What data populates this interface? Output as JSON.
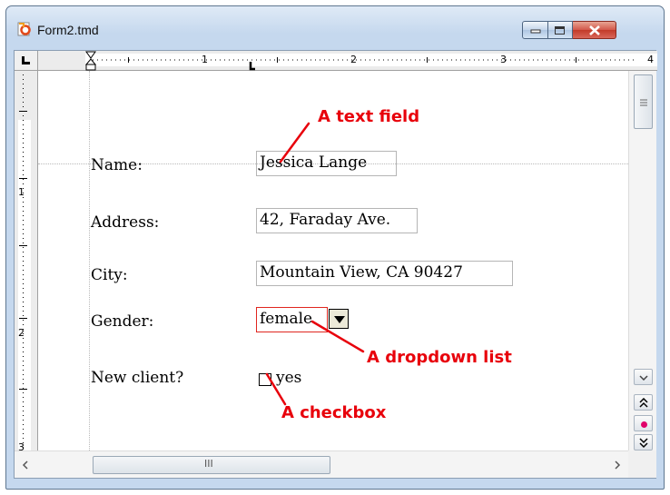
{
  "window": {
    "title": "Form2.tmd"
  },
  "ruler": {
    "h_marks": [
      "1",
      "2",
      "3",
      "4"
    ],
    "v_marks": [
      "1",
      "2",
      "3"
    ]
  },
  "form": {
    "fields": [
      {
        "label": "Name:",
        "value": "Jessica Lange"
      },
      {
        "label": "Address:",
        "value": "42, Faraday Ave."
      },
      {
        "label": "City:",
        "value": "Mountain View, CA 90427"
      }
    ],
    "gender": {
      "label": "Gender:",
      "value": "female"
    },
    "new_client": {
      "label": "New client?",
      "option": "yes",
      "checked": false
    }
  },
  "annotations": {
    "text_field": "A text field",
    "dropdown_list": "A dropdown list",
    "checkbox": "A checkbox"
  },
  "scrollbar": {
    "grip_glyph": "III"
  },
  "colors": {
    "annotation": "#e8000b",
    "field_border": "#b5b5b5",
    "highlight_border": "#e0261f"
  },
  "icons": [
    "app-icon",
    "minimize-icon",
    "maximize-icon",
    "close-icon",
    "tab-stop-icon",
    "indent-marker-icon",
    "scroll-up-icon",
    "scroll-down-icon",
    "scroll-left-icon",
    "scroll-right-icon",
    "prev-page-icon",
    "select-browse-object-icon",
    "next-page-icon"
  ]
}
